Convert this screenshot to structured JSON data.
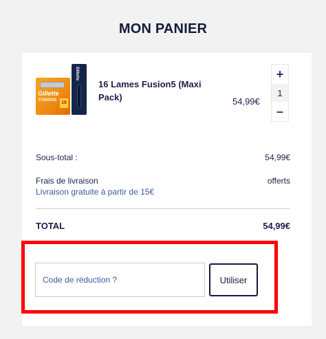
{
  "header": {
    "title": "MON PANIER"
  },
  "cart": {
    "item": {
      "name": "16 Lames Fusion5 (Maxi Pack)",
      "price": "54,99€",
      "quantity": "1",
      "increment_label": "+",
      "decrement_label": "–",
      "image": {
        "brand": "Gillette",
        "product_line": "FUSION5",
        "count_badge": "16"
      }
    },
    "summary": {
      "subtotal_label": "Sous-total :",
      "subtotal_value": "54,99€",
      "shipping_label": "Frais de livraison",
      "shipping_value": "offerts",
      "shipping_note": "Livraison gratuite à partir de 15€",
      "total_label": "TOTAL",
      "total_value": "54,99€"
    },
    "promo": {
      "placeholder": "Code de réduction ?",
      "button_label": "Utiliser"
    }
  },
  "colors": {
    "background": "#f2f2f2",
    "navy_text": "#1b1f4a",
    "link_blue": "#3b5a9a",
    "highlight_red": "#ff0000"
  }
}
